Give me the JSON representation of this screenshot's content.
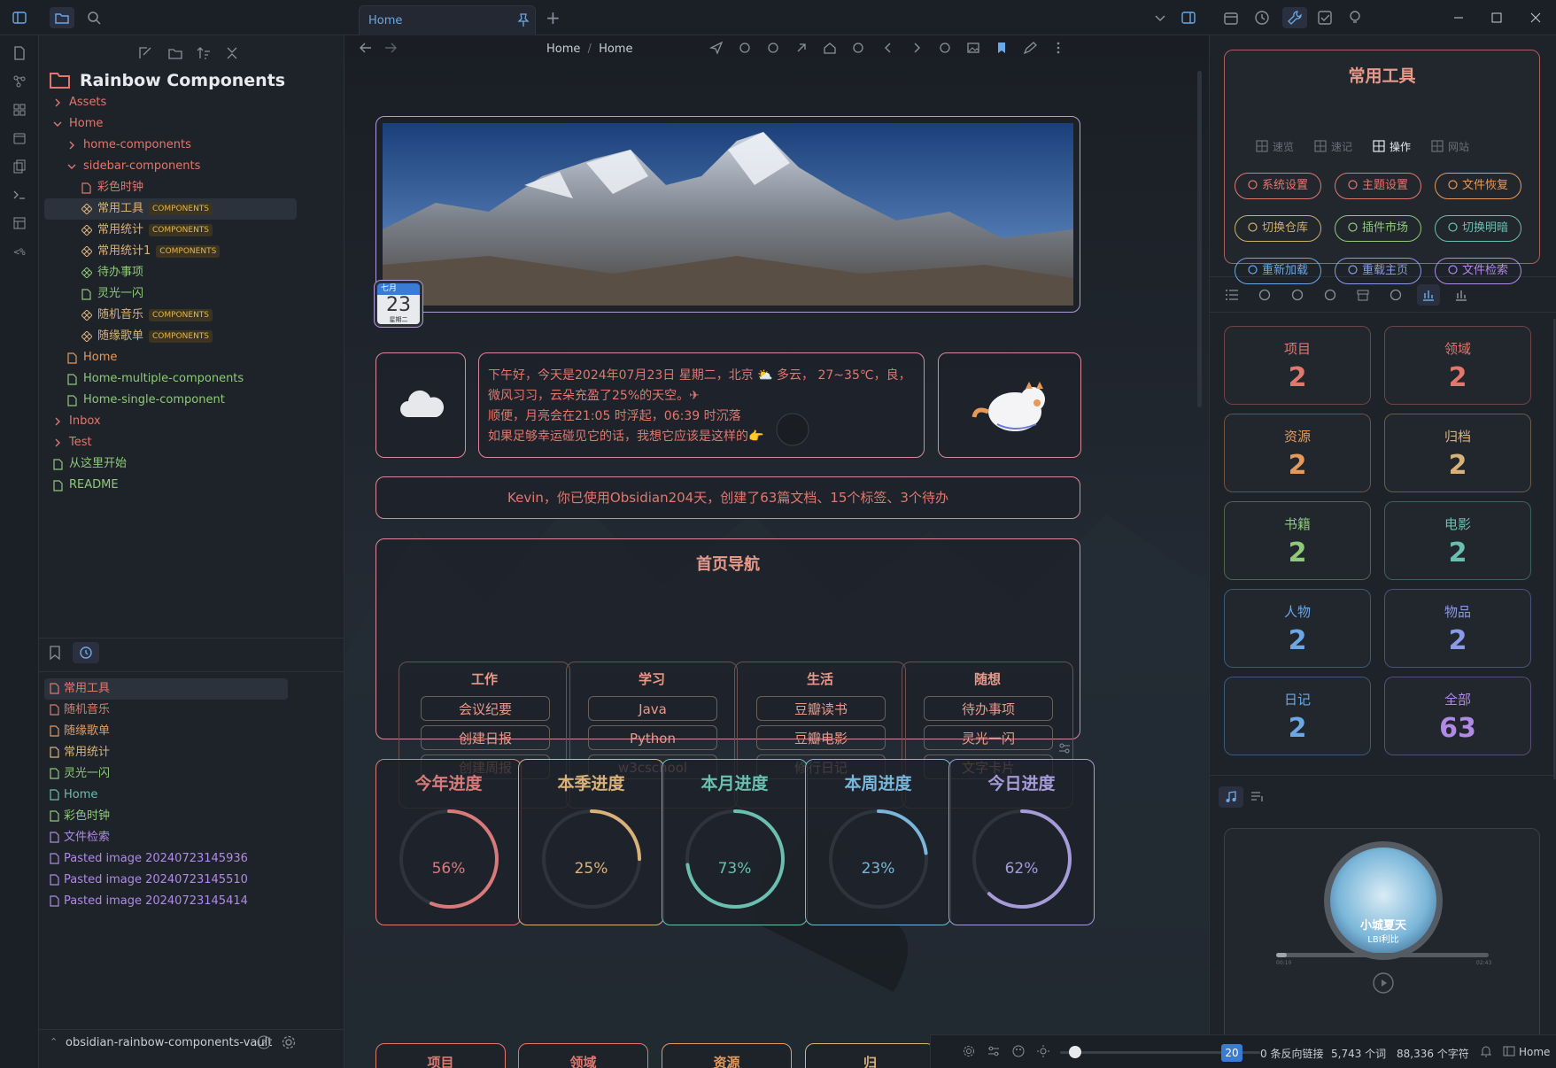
{
  "titlebar": {
    "tab_label": "Home",
    "new_tab": "+"
  },
  "nav": {
    "breadcrumb_1": "Home",
    "breadcrumb_sep": "/",
    "breadcrumb_2": "Home"
  },
  "sidebar": {
    "vault_title": "Rainbow Components",
    "tree": [
      {
        "label": "Assets",
        "type": "folder",
        "collapsed": true
      },
      {
        "label": "Home",
        "type": "folder",
        "collapsed": false
      },
      {
        "label": "home-components",
        "type": "folder",
        "collapsed": true
      },
      {
        "label": "sidebar-components",
        "type": "folder",
        "collapsed": false
      },
      {
        "label": "彩色时钟",
        "type": "file"
      },
      {
        "label": "常用工具",
        "type": "component",
        "badge": "COMPONENTS",
        "active": true
      },
      {
        "label": "常用统计",
        "type": "component",
        "badge": "COMPONENTS"
      },
      {
        "label": "常用统计1",
        "type": "component",
        "badge": "COMPONENTS"
      },
      {
        "label": "待办事项",
        "type": "component"
      },
      {
        "label": "灵光一闪",
        "type": "file"
      },
      {
        "label": "随机音乐",
        "type": "component",
        "badge": "COMPONENTS"
      },
      {
        "label": "随缘歌单",
        "type": "component",
        "badge": "COMPONENTS"
      },
      {
        "label": "Home",
        "type": "file"
      },
      {
        "label": "Home-multiple-components",
        "type": "file"
      },
      {
        "label": "Home-single-component",
        "type": "file"
      },
      {
        "label": "Inbox",
        "type": "folder",
        "collapsed": true
      },
      {
        "label": "Test",
        "type": "folder",
        "collapsed": true
      },
      {
        "label": "从这里开始",
        "type": "file"
      },
      {
        "label": "README",
        "type": "file"
      }
    ],
    "recent": [
      "常用工具",
      "随机音乐",
      "随缘歌单",
      "常用统计",
      "灵光一闪",
      "Home",
      "彩色时钟",
      "文件检索",
      "Pasted image 20240723145936",
      "Pasted image 20240723145510",
      "Pasted image 20240723145414"
    ],
    "vault_name": "obsidian-rainbow-components-vault"
  },
  "main": {
    "calendar": {
      "month": "七月",
      "day": "23",
      "weekday": "星期二"
    },
    "greeting": {
      "line1": "下午好，今天是2024年07月23日 星期二，北京 ⛅ 多云， 27~35℃，良，",
      "line2": "微风习习，云朵充盈了25%的天空。✈",
      "line3": "顺便，月亮会在21:05 时浮起，06:39 时沉落",
      "line4": "如果足够幸运碰见它的话，我想它应该是这样的👉"
    },
    "stats_line": "Kevin，你已使用Obsidian204天，创建了63篇文档、15个标签、3个待办",
    "home_nav": {
      "title": "首页导航",
      "groups": [
        {
          "title": "工作",
          "items": [
            "会议纪要",
            "创建日报",
            "创建周报"
          ]
        },
        {
          "title": "学习",
          "items": [
            "Java",
            "Python",
            "w3cschool"
          ]
        },
        {
          "title": "生活",
          "items": [
            "豆瓣读书",
            "豆瓣电影",
            "修行日记"
          ]
        },
        {
          "title": "随想",
          "items": [
            "待办事项",
            "灵光一闪",
            "文字卡片"
          ]
        }
      ]
    },
    "progress": [
      {
        "label": "今年进度",
        "value": 56,
        "pct": "56%",
        "color": "#d97a7a"
      },
      {
        "label": "本季进度",
        "value": 25,
        "pct": "25%",
        "color": "#d9b27a"
      },
      {
        "label": "本月进度",
        "value": 73,
        "pct": "73%",
        "color": "#6abfb0"
      },
      {
        "label": "本周进度",
        "value": 23,
        "pct": "23%",
        "color": "#7ab6d9"
      },
      {
        "label": "今日进度",
        "value": 62,
        "pct": "62%",
        "color": "#a69ad9"
      }
    ],
    "bottom_cards": [
      "项目",
      "领域",
      "资源",
      "归"
    ]
  },
  "right": {
    "tools_title": "常用工具",
    "tabs": [
      "速览",
      "速记",
      "操作",
      "网站"
    ],
    "tools": [
      {
        "label": "系统设置",
        "color": "#e0786e"
      },
      {
        "label": "主题设置",
        "color": "#e0786e"
      },
      {
        "label": "文件恢复",
        "color": "#e59a5a"
      },
      {
        "label": "切换仓库",
        "color": "#c9b06a"
      },
      {
        "label": "插件市场",
        "color": "#8fc97a"
      },
      {
        "label": "切换明暗",
        "color": "#6abfb0"
      },
      {
        "label": "重新加载",
        "color": "#6aa8e6"
      },
      {
        "label": "重载主页",
        "color": "#8a9ae6"
      },
      {
        "label": "文件检索",
        "color": "#b08ae6"
      }
    ],
    "stats": [
      {
        "label": "项目",
        "value": "2",
        "color": "#e0786e"
      },
      {
        "label": "领域",
        "value": "2",
        "color": "#e0786e"
      },
      {
        "label": "资源",
        "value": "2",
        "color": "#e59a5a"
      },
      {
        "label": "归档",
        "value": "2",
        "color": "#d9b27a"
      },
      {
        "label": "书籍",
        "value": "2",
        "color": "#8fc97a"
      },
      {
        "label": "电影",
        "value": "2",
        "color": "#6abfb0"
      },
      {
        "label": "人物",
        "value": "2",
        "color": "#6aa8e6"
      },
      {
        "label": "物品",
        "value": "2",
        "color": "#8a9ae6"
      },
      {
        "label": "日记",
        "value": "2",
        "color": "#6aa8e6"
      },
      {
        "label": "全部",
        "value": "63",
        "color": "#b08ae6"
      }
    ],
    "music": {
      "title": "小城夏天",
      "artist": "LBI利比",
      "time_start": "00:10",
      "time_end": "02:43",
      "progress": 0.05
    }
  },
  "status": {
    "zoom": "20",
    "backlinks": "0 条反向链接",
    "words": "5,743 个词",
    "chars": "88,336 个字符",
    "view": "Home"
  }
}
